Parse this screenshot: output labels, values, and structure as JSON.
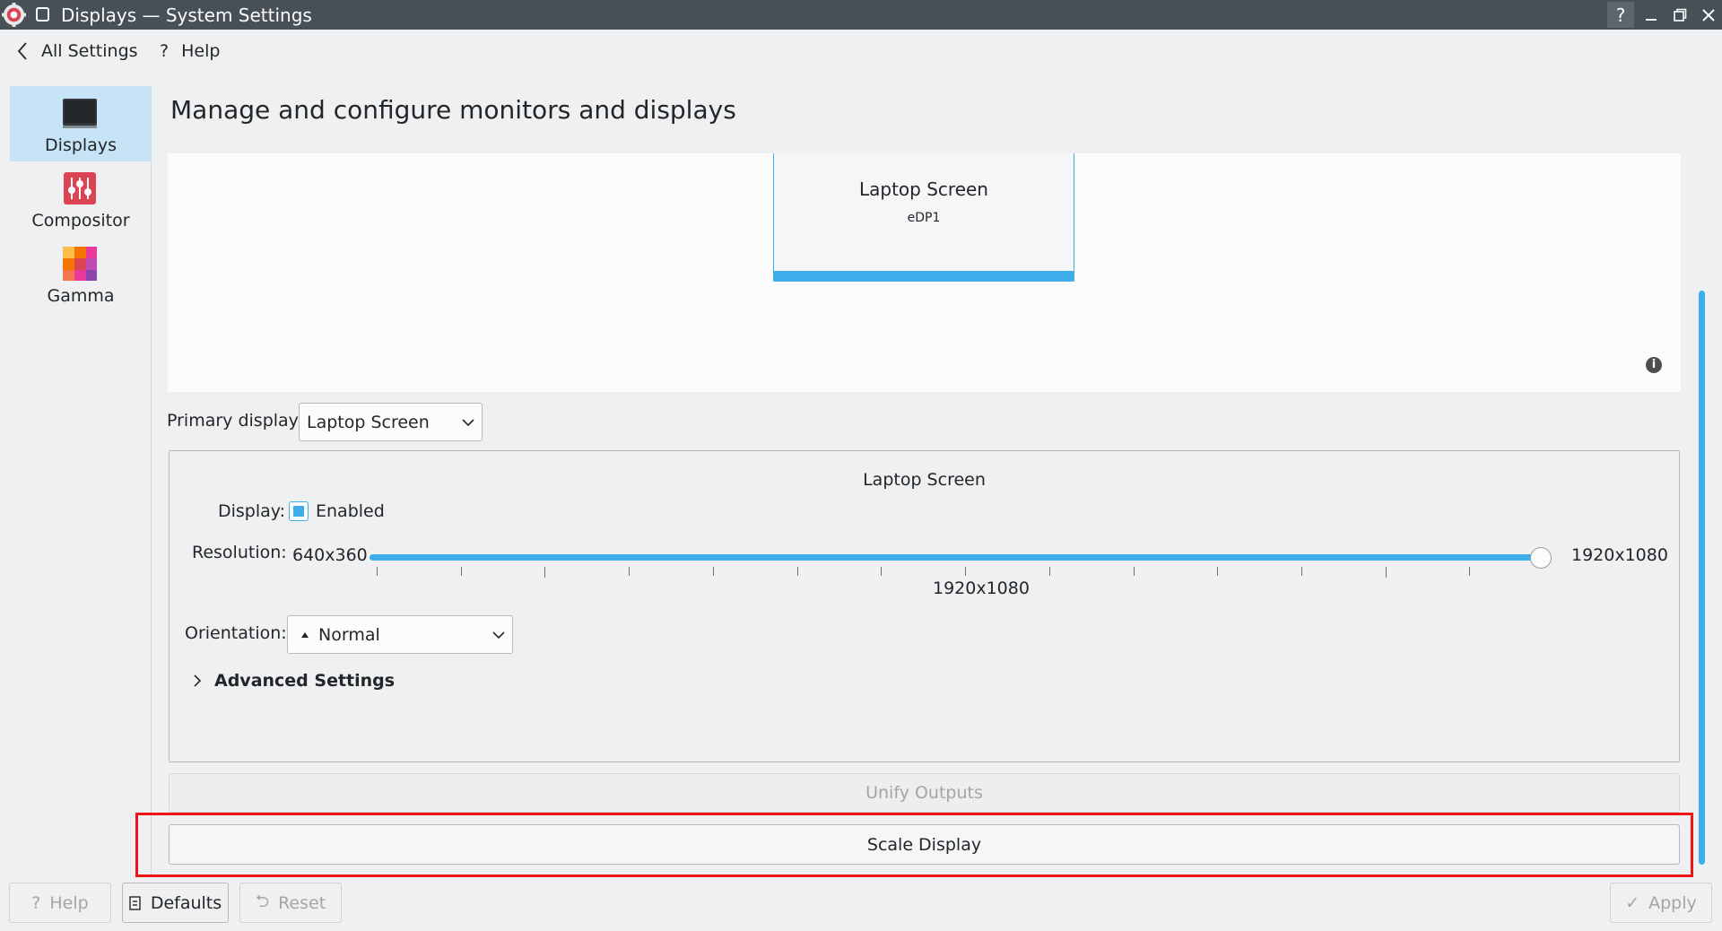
{
  "window": {
    "title": "Displays — System Settings",
    "help_glyph": "?"
  },
  "nav": {
    "back_label": "All Settings",
    "help_label": "Help",
    "help_glyph": "?"
  },
  "sidebar": {
    "items": [
      {
        "label": "Displays",
        "icon": "monitor-icon",
        "active": true
      },
      {
        "label": "Compositor",
        "icon": "compositor-icon",
        "active": false
      },
      {
        "label": "Gamma",
        "icon": "gamma-icon",
        "active": false
      }
    ]
  },
  "main": {
    "title": "Manage and configure monitors and displays",
    "monitor": {
      "name": "Laptop Screen",
      "id": "eDP1"
    },
    "info_glyph": "i",
    "primary_display": {
      "label": "Primary display:",
      "value": "Laptop Screen"
    },
    "output": {
      "title": "Laptop Screen",
      "display_label": "Display:",
      "enabled_label": "Enabled",
      "enabled": true,
      "resolution_label": "Resolution:",
      "resolution_min": "640x360",
      "resolution_max": "1920x1080",
      "resolution_current": "1920x1080",
      "resolution_position": 1.0,
      "orientation_label": "Orientation:",
      "orientation_value": "Normal",
      "advanced_label": "Advanced Settings"
    },
    "unify_label": "Unify Outputs",
    "scale_label": "Scale Display"
  },
  "footer": {
    "help_label": "Help",
    "help_glyph": "?",
    "defaults_label": "Defaults",
    "reset_label": "Reset",
    "reset_glyph": "⮌",
    "apply_label": "Apply",
    "apply_glyph": "✓"
  },
  "colors": {
    "accent": "#3daee9",
    "titlebar": "#475057",
    "highlight": "#ed1515",
    "sidebar_active": "#c7e4f6"
  }
}
